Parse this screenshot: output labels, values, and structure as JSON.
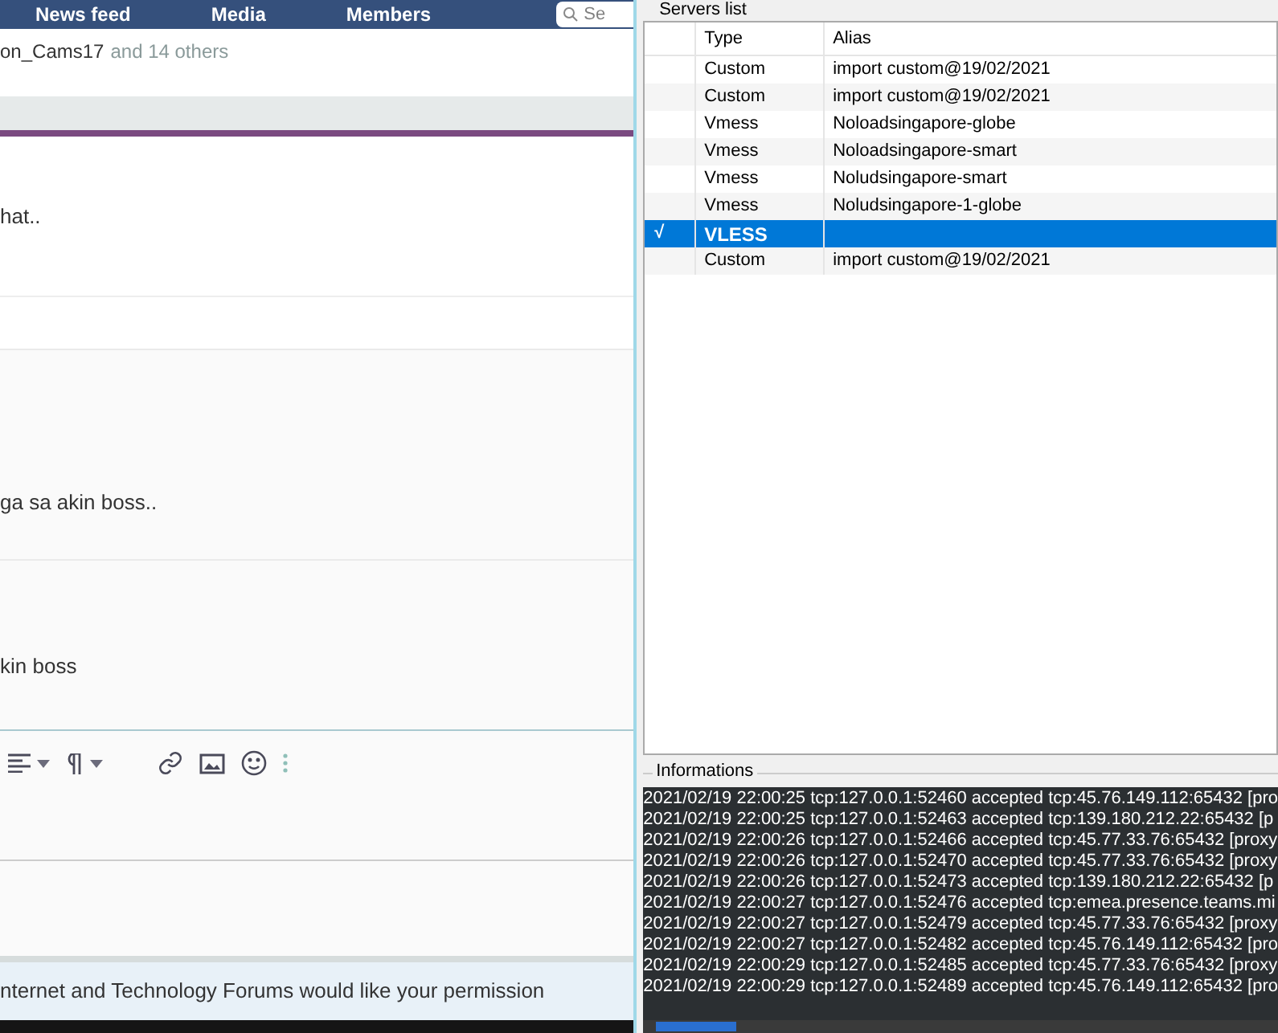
{
  "forum": {
    "nav": [
      {
        "label": "News feed"
      },
      {
        "label": "Media"
      },
      {
        "label": "Members"
      }
    ],
    "search": {
      "placeholder": "Se"
    },
    "reactions": {
      "names": "on_Cams17",
      "others": "and 14 others"
    },
    "messages": [
      "hat..",
      "ga sa akin boss..",
      "kin boss"
    ],
    "banner": "nternet and Technology Forums would like your permission"
  },
  "app": {
    "servers_group": "Servers list",
    "columns": [
      "Type",
      "Alias"
    ],
    "rows": [
      {
        "type": "Custom",
        "alias": "import custom@19/02/2021",
        "selected": false,
        "active": false,
        "check": ""
      },
      {
        "type": "Custom",
        "alias": "import custom@19/02/2021",
        "selected": false,
        "active": false,
        "check": ""
      },
      {
        "type": "Vmess",
        "alias": "Noloadsingapore-globe",
        "selected": false,
        "active": false,
        "check": ""
      },
      {
        "type": "Vmess",
        "alias": "Noloadsingapore-smart",
        "selected": false,
        "active": false,
        "check": ""
      },
      {
        "type": "Vmess",
        "alias": "Noludsingapore-smart",
        "selected": false,
        "active": false,
        "check": ""
      },
      {
        "type": "Vmess",
        "alias": "Noludsingapore-1-globe",
        "selected": false,
        "active": false,
        "check": ""
      },
      {
        "type": "VLESS",
        "alias": "",
        "selected": true,
        "active": true,
        "check": "√"
      },
      {
        "type": "Custom",
        "alias": "import custom@19/02/2021",
        "selected": false,
        "active": false,
        "check": ""
      }
    ],
    "info_group": "Informations",
    "log": [
      "2021/02/19 22:00:25 tcp:127.0.0.1:52460 accepted tcp:45.76.149.112:65432 [pro",
      "2021/02/19 22:00:25 tcp:127.0.0.1:52463 accepted tcp:139.180.212.22:65432 [p",
      "2021/02/19 22:00:26 tcp:127.0.0.1:52466 accepted tcp:45.77.33.76:65432 [proxy",
      "2021/02/19 22:00:26 tcp:127.0.0.1:52470 accepted tcp:45.77.33.76:65432 [proxy",
      "2021/02/19 22:00:26 tcp:127.0.0.1:52473 accepted tcp:139.180.212.22:65432 [p",
      "2021/02/19 22:00:27 tcp:127.0.0.1:52476 accepted tcp:emea.presence.teams.mi",
      "2021/02/19 22:00:27 tcp:127.0.0.1:52479 accepted tcp:45.77.33.76:65432 [proxy",
      "2021/02/19 22:00:27 tcp:127.0.0.1:52482 accepted tcp:45.76.149.112:65432 [pro",
      "2021/02/19 22:00:29 tcp:127.0.0.1:52485 accepted tcp:45.77.33.76:65432 [proxy",
      "2021/02/19 22:00:29 tcp:127.0.0.1:52489 accepted tcp:45.76.149.112:65432 [pro"
    ]
  }
}
